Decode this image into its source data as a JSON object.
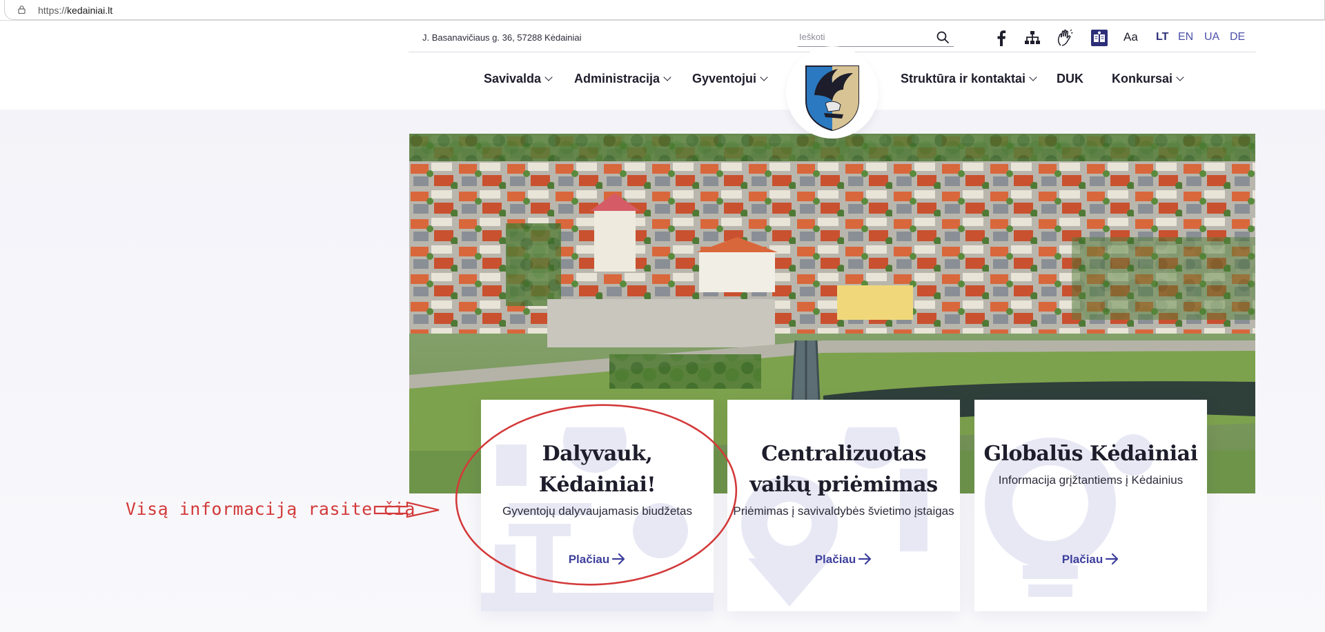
{
  "browser": {
    "url_prefix": "https://",
    "url_host": "kedainiai.lt"
  },
  "topbar": {
    "address": "J. Basanavičiaus g. 36, 57288 Kėdainiai",
    "search_placeholder": "Ieškoti",
    "font_size_label": "Aa",
    "languages": [
      {
        "code": "LT",
        "active": true
      },
      {
        "code": "EN",
        "active": false
      },
      {
        "code": "UA",
        "active": false
      },
      {
        "code": "DE",
        "active": false
      }
    ],
    "icons": [
      "facebook-icon",
      "sitemap-icon",
      "sign-language-icon",
      "easy-read-icon"
    ]
  },
  "nav": {
    "items": [
      {
        "label": "Savivalda",
        "dropdown": true
      },
      {
        "label": "Administracija",
        "dropdown": true
      },
      {
        "label": "Gyventojui",
        "dropdown": true
      },
      {
        "label": "Struktūra ir kontaktai",
        "dropdown": true
      },
      {
        "label": "DUK",
        "dropdown": false
      },
      {
        "label": "Konkursai",
        "dropdown": true
      }
    ]
  },
  "cards": [
    {
      "title": "Dalyvauk, Kėdainiai!",
      "subtitle": "Gyventojų dalyvaujamasis biudžetas",
      "link": "Plačiau"
    },
    {
      "title": "Centralizuotas vaikų priėmimas",
      "subtitle": "Priėmimas į savivaldybės švietimo įstaigas",
      "link": "Plačiau"
    },
    {
      "title": "Globalūs Kėdainiai",
      "subtitle": "Informacija grįžtantiems į Kėdainius",
      "link": "Plačiau"
    }
  ],
  "annotation": {
    "text": "Visą informaciją rasite čia"
  },
  "colors": {
    "accent": "#3d3f9c",
    "annotation": "#d33a3a",
    "text": "#1d1d2b"
  }
}
